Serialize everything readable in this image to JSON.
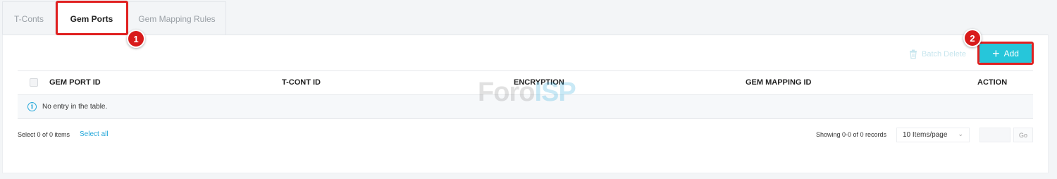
{
  "tabs": [
    {
      "label": "T-Conts",
      "active": false
    },
    {
      "label": "Gem Ports",
      "active": true
    },
    {
      "label": "Gem Mapping Rules",
      "active": false
    }
  ],
  "annotations": {
    "badge_1": "1",
    "badge_2": "2",
    "color": "#e02020"
  },
  "toolbar": {
    "batch_delete_label": "Batch Delete",
    "add_label": "Add",
    "add_color": "#26c6da"
  },
  "table": {
    "columns": [
      "GEM PORT ID",
      "T-CONT ID",
      "ENCRYPTION",
      "GEM MAPPING ID",
      "ACTION"
    ],
    "empty_text": "No entry in the table."
  },
  "watermark": {
    "part1": "Foro",
    "part2": "ISP"
  },
  "footer": {
    "selected_text": "Select 0 of 0 items",
    "select_all": "Select all",
    "showing": "Showing 0-0 of 0 records",
    "page_size": "10 Items/page",
    "go_label": "Go"
  },
  "icons": {
    "trash": "trash-icon",
    "plus": "plus-icon",
    "info": "info-icon",
    "chevron": "chevron-down-icon"
  }
}
